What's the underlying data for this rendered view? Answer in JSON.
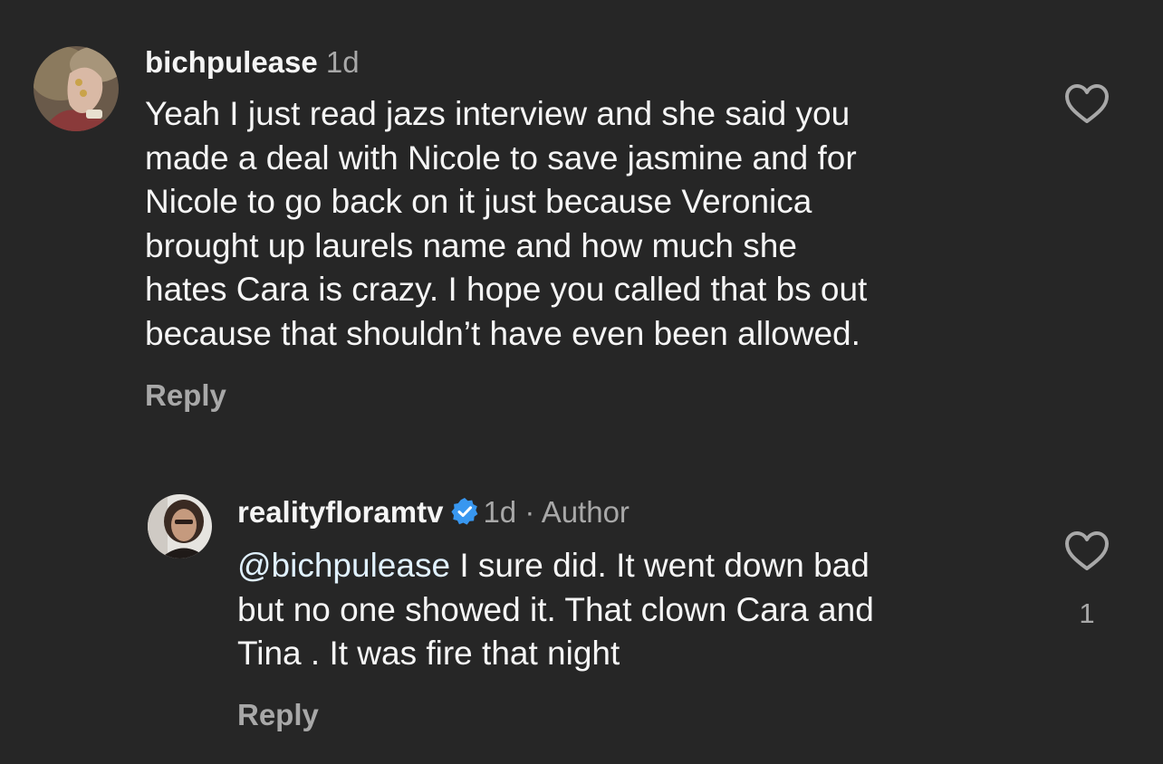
{
  "comments": [
    {
      "username": "bichpulease",
      "time": "1d",
      "lines": [
        "Yeah I just read jazs interview and she said you",
        "made a deal with Nicole to save jasmine and for",
        "Nicole to go back on it just because Veronica",
        "brought up laurels name and how much she",
        "hates Cara is crazy. I hope you called that bs out",
        "because that shouldn’t have even been allowed."
      ],
      "reply_label": "Reply",
      "like_icon": "heart-outline-icon"
    },
    {
      "username": "realityfloramtv",
      "verified": true,
      "time": "1d",
      "separator": "·",
      "author_tag": "Author",
      "mention": "@bichpulease",
      "lines": [
        " I sure did. It went down bad",
        "but no one showed it. That clown Cara and",
        "Tina . It was fire that night"
      ],
      "reply_label": "Reply",
      "like_icon": "heart-outline-icon",
      "like_count": "1"
    }
  ],
  "colors": {
    "background": "#262626",
    "primary_text": "#f5f5f5",
    "secondary_text": "#a8a8a8",
    "mention": "#e0f1ff",
    "verified_badge": "#3897f0"
  }
}
